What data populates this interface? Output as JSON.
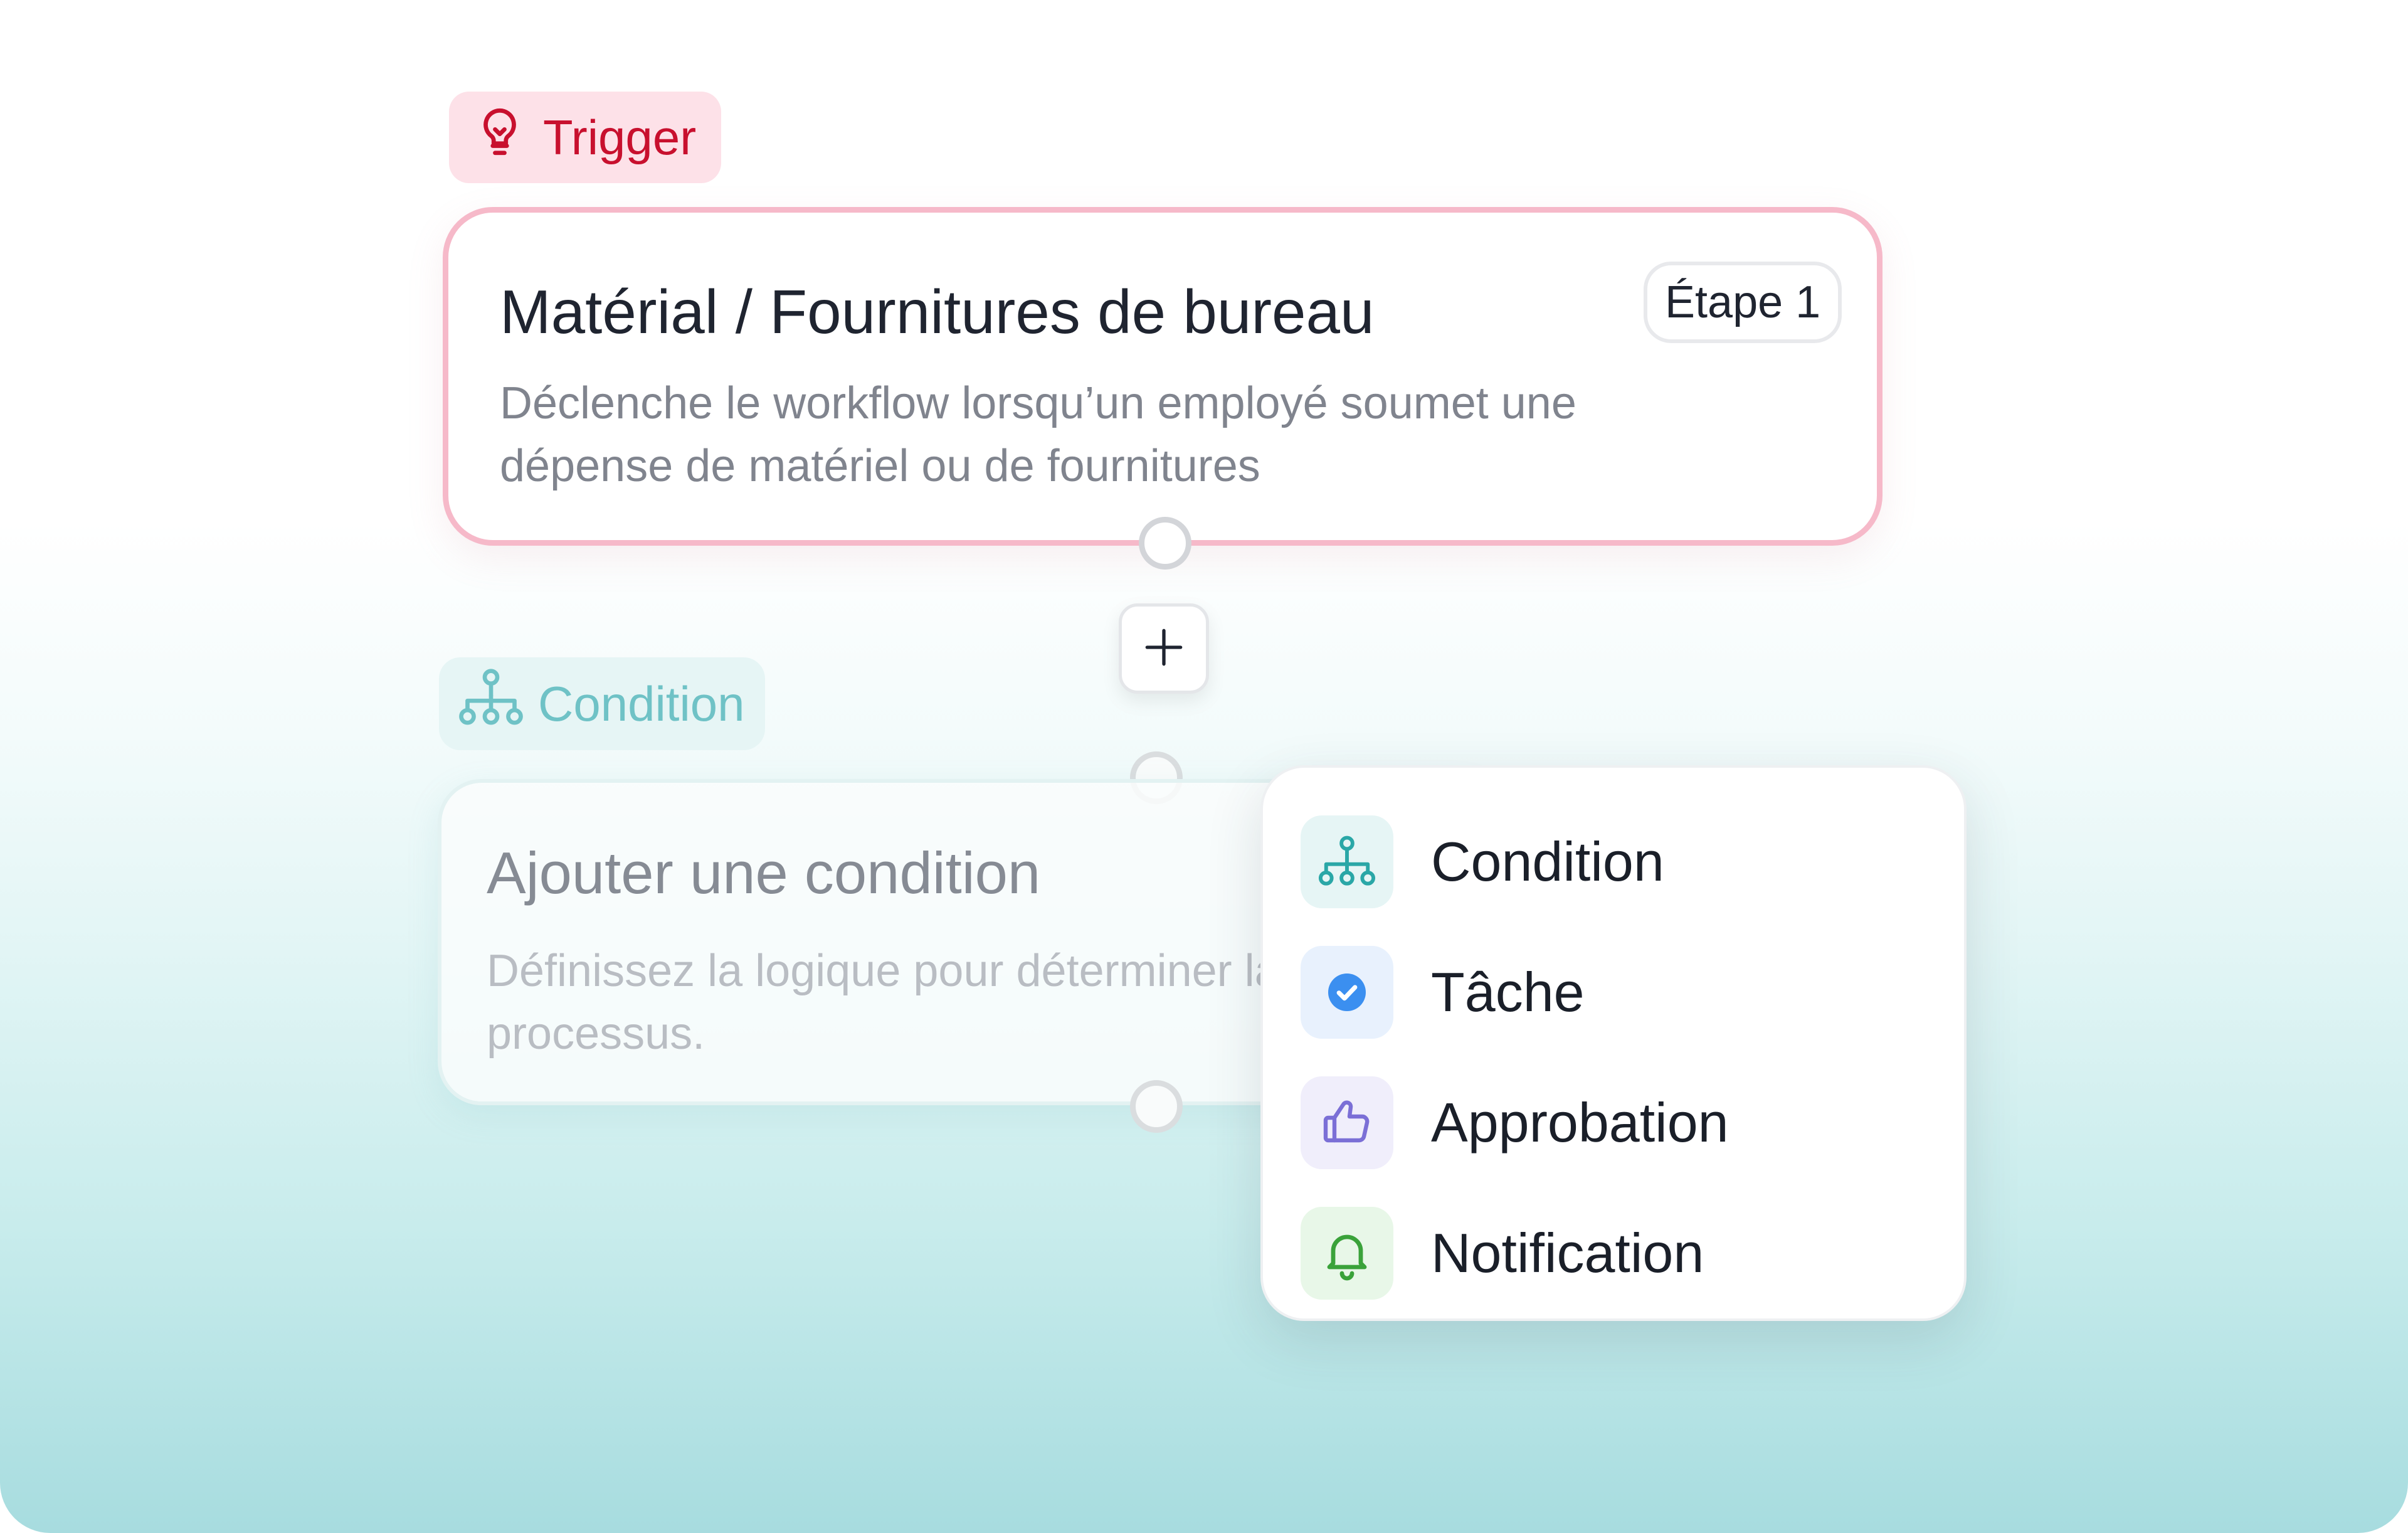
{
  "trigger": {
    "badge_label": "Trigger",
    "badge_icon": "lightbulb-icon",
    "title": "Matérial / Fournitures de bureau",
    "step": "Étape 1",
    "description": "Déclenche le workflow lorsqu’un employé soumet une dépense de matériel ou de fournitures",
    "accent_color": "#c8102e",
    "border_color": "#f6b9c9"
  },
  "add_button": {
    "icon": "plus-icon"
  },
  "condition": {
    "badge_label": "Condition",
    "badge_icon": "hierarchy-icon",
    "title": "Ajouter une condition",
    "description": "Définissez la logique pour déterminer la suite du processus.",
    "accent_color": "#6fc2c6"
  },
  "menu": {
    "items": [
      {
        "label": "Condition",
        "icon": "hierarchy-icon",
        "icon_bg": "#e6f5f5",
        "icon_color": "#2aa7a7"
      },
      {
        "label": "Tâche",
        "icon": "check-circle-icon",
        "icon_bg": "#e8f1fd",
        "icon_color": "#3b8ff0"
      },
      {
        "label": "Approbation",
        "icon": "thumbs-up-icon",
        "icon_bg": "#f0eefb",
        "icon_color": "#7b6fd6"
      },
      {
        "label": "Notification",
        "icon": "bell-icon",
        "icon_bg": "#e8f7e8",
        "icon_color": "#3aa23a"
      }
    ]
  }
}
